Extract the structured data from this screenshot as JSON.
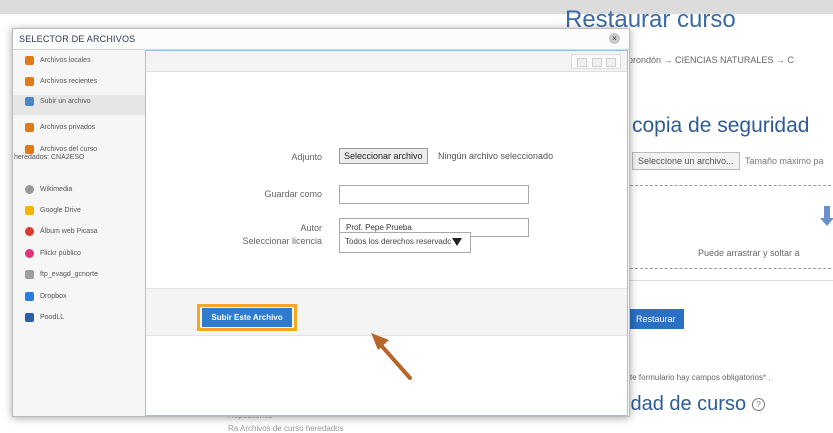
{
  "page": {
    "title": "Restaurar curso",
    "breadcrumb": "orondón  →  CIENCIAS NATURALES  →  C",
    "section_heading": "copia de seguridad",
    "choose_file_button": "Seleccione un archivo...",
    "max_size_text": "Tamaño máximo pa",
    "drop_text": "Puede arrastrar y soltar a",
    "restore_button": "Restaurar",
    "required_note": "ste formulario hay campos obligatorios",
    "required_asterisk": "*",
    "required_suffix": " .",
    "section_heading_2": "idad de curso",
    "help_icon_glyph": "?",
    "ghost_text_1": "Repositorios",
    "ghost_text_2": "Ra Archivos de curso heredados"
  },
  "modal": {
    "title": "SELECTOR DE ARCHIVOS",
    "close_glyph": "×",
    "sidebar": [
      {
        "label": "Archivos locales",
        "icon": "moodle-icon",
        "color": "#e07b1a"
      },
      {
        "label": "Archivos recientes",
        "icon": "moodle-icon",
        "color": "#e07b1a"
      },
      {
        "label": "Subir un archivo",
        "icon": "upload-icon",
        "color": "#4a86c5",
        "active": true
      },
      {
        "label": "Archivos privados",
        "icon": "moodle-icon",
        "color": "#e07b1a"
      },
      {
        "label": "Archivos del curso",
        "label2": "heredados: CNA2ESO",
        "icon": "moodle-icon",
        "color": "#e07b1a"
      },
      {
        "label": "Wikimedia",
        "icon": "wikimedia-icon",
        "color": "#999999"
      },
      {
        "label": "Google Drive",
        "icon": "google-drive-icon",
        "color": "#f4b400"
      },
      {
        "label": "Álbum web Picasa",
        "icon": "picasa-icon",
        "color": "#d93a2b"
      },
      {
        "label": "Flickr público",
        "icon": "flickr-icon",
        "color": "#e0337c"
      },
      {
        "label": "ftp_evagd_gcnorte",
        "icon": "ftp-icon",
        "color": "#9e9e9e"
      },
      {
        "label": "Dropbox",
        "icon": "dropbox-icon",
        "color": "#2a7de1"
      },
      {
        "label": "PoodLL",
        "icon": "poodll-icon",
        "color": "#2a5fa8"
      }
    ],
    "form": {
      "attachment_label": "Adjunto",
      "file_button": "Seleccionar archivo",
      "file_status": "Ningún archivo seleccionado",
      "save_as_label": "Guardar como",
      "save_as_value": "",
      "author_label": "Autor",
      "author_value": "Prof. Pepe Prueba",
      "license_label": "Seleccionar licencia",
      "license_value": "Todos los derechos reservadc",
      "upload_button": "Subir Este Archivo"
    }
  },
  "colors": {
    "accent": "#2f7ccf",
    "highlight": "#f5a623",
    "pointer_arrow": "#b8652a"
  }
}
